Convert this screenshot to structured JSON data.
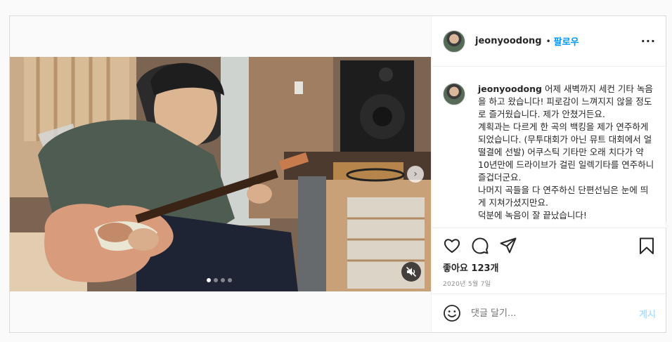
{
  "header": {
    "username": "jeonyoodong",
    "separator": "•",
    "follow_label": "팔로우",
    "more_icon": "more-horizontal-icon"
  },
  "caption": {
    "username": "jeonyoodong",
    "text": "어제 새벽까지 세컨 기타 녹음을 하고 왔습니다! 피로감이 느껴지지 않을 정도로 즐거웠습니다. 제가 안쳤거든요.\n계획과는 다르게 한 곡의 백킹을 제가 연주하게 되었습니다. (무투대회가 아닌 뮤트 대회에서 얼떨결에 선발) 어쿠스틱 기타만 오래 치다가 약 10년만에 드라이브가 걸린 일렉기타를 연주하니 즐겁더군요.\n나머지 곡들을 다 연주하신 단편선님은 눈에 띄게 지쳐가셨지만요.\n덕분에 녹음이 잘 끝났습니다!"
  },
  "actions": {
    "like_icon": "heart-icon",
    "comment_icon": "comment-icon",
    "share_icon": "send-icon",
    "save_icon": "bookmark-icon",
    "likes": "좋아요 123개",
    "date": "2020년 5월 7일"
  },
  "comment_box": {
    "emoji_icon": "emoji-icon",
    "placeholder": "댓글 달기...",
    "post_label": "게시"
  },
  "media": {
    "slide_count": 4,
    "active_slide": 1,
    "next_icon": "chevron-right-icon",
    "mute_icon": "muted-speaker-icon"
  }
}
